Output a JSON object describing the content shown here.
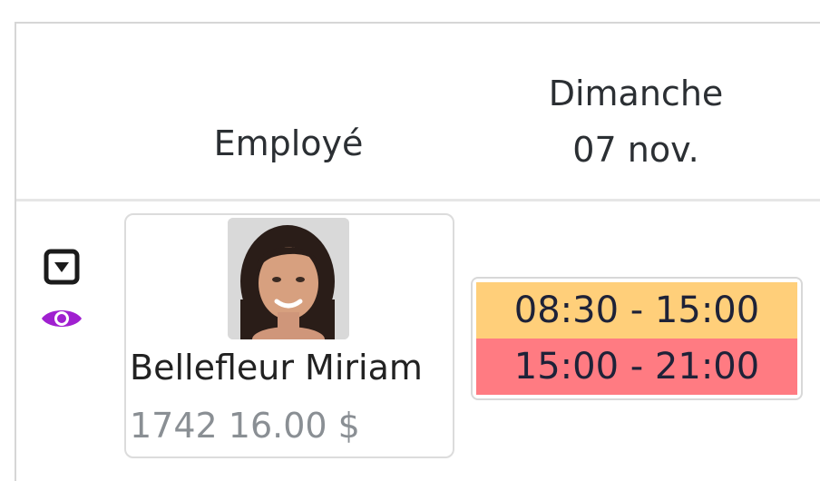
{
  "header": {
    "employee_col": "Employé",
    "day_name": "Dimanche",
    "day_date": "07 nov."
  },
  "row_actions": {
    "toggle_icon": "caret-down-square-icon",
    "view_icon": "eye-icon",
    "view_color": "#a020d0"
  },
  "employee": {
    "name": "Bellefleur Miriam",
    "meta": "1742 16.00 $",
    "avatar": "avatar-photo"
  },
  "shifts": [
    {
      "label": "08:30 - 15:00",
      "color": "#ffcf7a"
    },
    {
      "label": "15:00 - 21:00",
      "color": "#ff7b82"
    }
  ]
}
